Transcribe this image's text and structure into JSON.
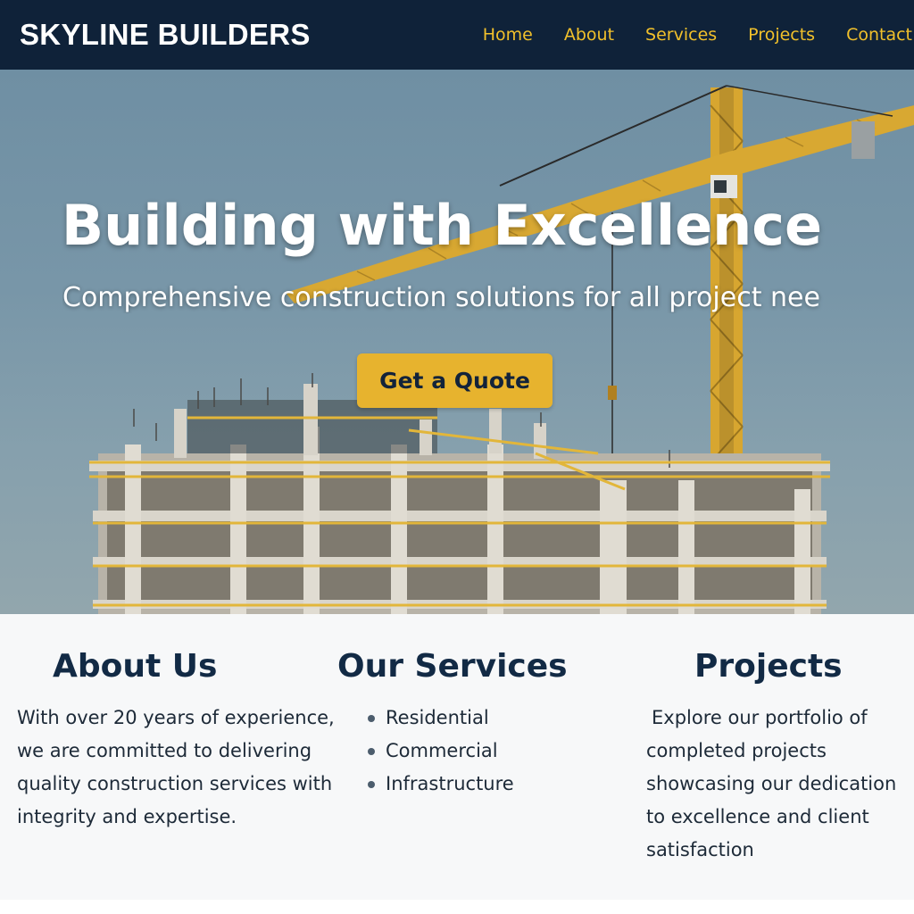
{
  "header": {
    "brand": "SKYLINE BUILDERS",
    "nav": [
      "Home",
      "About",
      "Services",
      "Projects",
      "Contact"
    ]
  },
  "hero": {
    "title": "Building with Excellence",
    "subtitle": "Comprehensive construction solutions for all project nee",
    "cta_label": "Get a Quote"
  },
  "about": {
    "heading": "About Us",
    "text": "With over 20 years of experience, we are committed to delivering quality construction services with integrity and expertise."
  },
  "services": {
    "heading": "Our Services",
    "items": [
      "Residential",
      "Commercial",
      "Infrastructure"
    ]
  },
  "projects": {
    "heading": "Projects",
    "text": "Explore our portfolio of completed projects showcasing our dedication to excellence and client satisfaction"
  },
  "colors": {
    "header_bg": "#0f2239",
    "accent": "#f1c02b",
    "button_bg": "#e7b32e",
    "heading_text": "#122a45"
  }
}
